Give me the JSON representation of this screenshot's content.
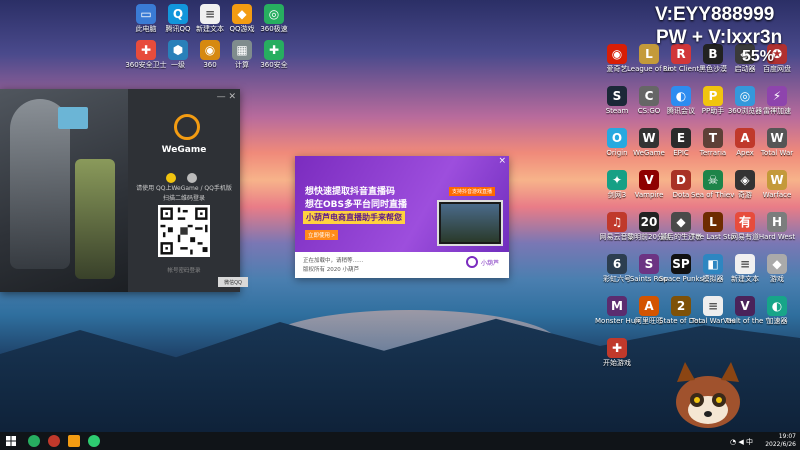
{
  "overlay": {
    "line1": "V:EYY888999",
    "line2": "PW + V:lxxr3n",
    "percent": "55%"
  },
  "top_icons": [
    {
      "label": "此电脑",
      "color": "#3a7bd5",
      "glyph": "▭",
      "icon": "computer-icon"
    },
    {
      "label": "腾讯QQ",
      "color": "#1296db",
      "glyph": "Q",
      "icon": "qq-icon"
    },
    {
      "label": "新建文本",
      "color": "#f0f0f0",
      "glyph": "≡",
      "icon": "document-icon"
    },
    {
      "label": "QQ游戏",
      "color": "#f39c12",
      "glyph": "◆",
      "icon": "qqgame-icon"
    },
    {
      "label": "360极速",
      "color": "#27ae60",
      "glyph": "◎",
      "icon": "browser-icon"
    },
    {
      "label": "360安全卫士",
      "color": "#e74c3c",
      "glyph": "✚",
      "icon": "security-icon"
    },
    {
      "label": "一级",
      "color": "#2980b9",
      "glyph": "⬢",
      "icon": "app-icon"
    },
    {
      "label": "360",
      "color": "#d68910",
      "glyph": "◉",
      "icon": "folder-icon"
    },
    {
      "label": "计算",
      "color": "#7f8c8d",
      "glyph": "▦",
      "icon": "calc-icon"
    },
    {
      "label": "360安全",
      "color": "#27ae60",
      "glyph": "✚",
      "icon": "shield-icon"
    }
  ],
  "right_icons": [
    {
      "label": "爱奇艺",
      "color": "#d81e06",
      "glyph": "◉",
      "icon": "app-icon"
    },
    {
      "label": "League of Legends",
      "color": "#c49a3a",
      "glyph": "L",
      "icon": "lol-icon"
    },
    {
      "label": "Riot Client",
      "color": "#d13639",
      "glyph": "R",
      "icon": "riot-icon"
    },
    {
      "label": "黑色沙漠",
      "color": "#222222",
      "glyph": "B",
      "icon": "game-icon"
    },
    {
      "label": "启动器",
      "color": "#3a3a3a",
      "glyph": "◆",
      "icon": "launcher-icon"
    },
    {
      "label": "百度网盘",
      "color": "#b03030",
      "glyph": "✪",
      "icon": "netdisk-icon"
    },
    {
      "label": "Steam",
      "color": "#1b2838",
      "glyph": "S",
      "icon": "steam-icon"
    },
    {
      "label": "CS:GO",
      "color": "#666666",
      "glyph": "C",
      "icon": "csgo-icon"
    },
    {
      "label": "腾讯会议",
      "color": "#2d8cf0",
      "glyph": "◐",
      "icon": "meeting-icon"
    },
    {
      "label": "PP助手",
      "color": "#f1c40f",
      "glyph": "P",
      "icon": "pp-icon"
    },
    {
      "label": "360浏览器",
      "color": "#3498db",
      "glyph": "◎",
      "icon": "browser-icon"
    },
    {
      "label": "雷神加速",
      "color": "#8e44ad",
      "glyph": "⚡",
      "icon": "booster-icon"
    },
    {
      "label": "Origin",
      "color": "#26a9e0",
      "glyph": "O",
      "icon": "origin-icon"
    },
    {
      "label": "WeGame",
      "color": "#333333",
      "glyph": "W",
      "icon": "wegame-icon"
    },
    {
      "label": "EPIC",
      "color": "#2b2b2b",
      "glyph": "E",
      "icon": "epic-icon"
    },
    {
      "label": "Terraria",
      "color": "#5d4037",
      "glyph": "T",
      "icon": "game-icon"
    },
    {
      "label": "Apex",
      "color": "#c0392b",
      "glyph": "A",
      "icon": "game-icon"
    },
    {
      "label": "Total War",
      "color": "#555555",
      "glyph": "W",
      "icon": "game-icon"
    },
    {
      "label": "剑网3",
      "color": "#16a085",
      "glyph": "✦",
      "icon": "game-icon"
    },
    {
      "label": "Vampire",
      "color": "#8e0000",
      "glyph": "V",
      "icon": "game-icon"
    },
    {
      "label": "Dota",
      "color": "#a93226",
      "glyph": "D",
      "icon": "dota-icon"
    },
    {
      "label": "Sea of Thieves",
      "color": "#1e8449",
      "glyph": "☠",
      "icon": "game-icon"
    },
    {
      "label": "奇游",
      "color": "#333333",
      "glyph": "◈",
      "icon": "game-icon"
    },
    {
      "label": "Warface",
      "color": "#c49a3a",
      "glyph": "W",
      "icon": "game-icon"
    },
    {
      "label": "网易云音乐",
      "color": "#c0392b",
      "glyph": "♫",
      "icon": "music-icon"
    },
    {
      "label": "黎明前20分钟",
      "color": "#222222",
      "glyph": "20",
      "icon": "game-icon"
    },
    {
      "label": "最后的生还者",
      "color": "#4a4a4a",
      "glyph": "◆",
      "icon": "game-icon"
    },
    {
      "label": "The Last Stand",
      "color": "#6e2c00",
      "glyph": "L",
      "icon": "game-icon"
    },
    {
      "label": "网易有道",
      "color": "#e74c3c",
      "glyph": "有",
      "icon": "dict-icon"
    },
    {
      "label": "Hard West",
      "color": "#7b7d7d",
      "glyph": "H",
      "icon": "game-icon"
    },
    {
      "label": "彩虹六号",
      "color": "#2c3e50",
      "glyph": "6",
      "icon": "game-icon"
    },
    {
      "label": "Saints Row",
      "color": "#6c3483",
      "glyph": "S",
      "icon": "game-icon"
    },
    {
      "label": "Space Punks",
      "color": "#111111",
      "glyph": "SP",
      "icon": "game-icon"
    },
    {
      "label": "模拟器",
      "color": "#2e86c1",
      "glyph": "◧",
      "icon": "game-icon"
    },
    {
      "label": "新建文本",
      "color": "#f0f0f0",
      "glyph": "≡",
      "icon": "document-icon"
    },
    {
      "label": "游戏",
      "color": "#aaaaaa",
      "glyph": "◆",
      "icon": "game-icon"
    },
    {
      "label": "Monster Hunter",
      "color": "#5b2c6f",
      "glyph": "M",
      "icon": "game-icon"
    },
    {
      "label": "阿里旺旺",
      "color": "#d35400",
      "glyph": "A",
      "icon": "app-icon"
    },
    {
      "label": "State of Decay 2",
      "color": "#7e5109",
      "glyph": "2",
      "icon": "game-icon"
    },
    {
      "label": "Total War THREE",
      "color": "#eeeeee",
      "glyph": "≡",
      "icon": "game-icon"
    },
    {
      "label": "Vault of the Void",
      "color": "#4a235a",
      "glyph": "V",
      "icon": "game-icon"
    },
    {
      "label": "加速器",
      "color": "#17a589",
      "glyph": "◐",
      "icon": "booster-icon"
    },
    {
      "label": "开始游戏",
      "color": "#c0392b",
      "glyph": "✚",
      "icon": "game-icon"
    }
  ],
  "wegame": {
    "brand": "WeGame",
    "hint": "请使用 QQ上WeGame / QQ手机版",
    "hint2": "扫描二维码登录",
    "small": "帐号密码登录",
    "button": "微信QQ"
  },
  "ad": {
    "line1": "想快速提取抖音直播码",
    "line2": "想在OBS多平台同时直播",
    "line3": "小葫芦电商直播助手来帮您",
    "cta": "立即使用 >",
    "tag": "支持抖音游戏直播",
    "bottom1": "正在加载中，请稍等……",
    "bottom2": "版权所有 2020 小葫芦",
    "brandname": "小葫芦",
    "close": "×"
  },
  "taskbar": {
    "time": "19:07",
    "date": "2022/6/26"
  }
}
